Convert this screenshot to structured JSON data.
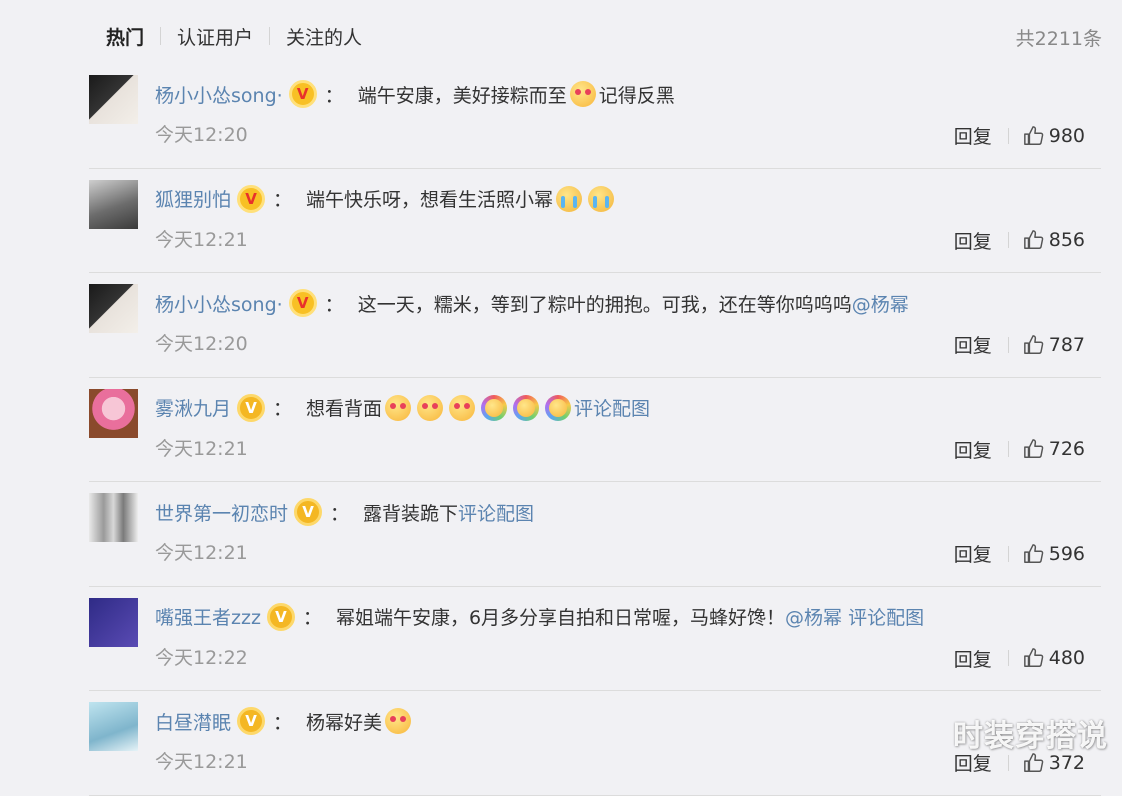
{
  "tabs": [
    "热门",
    "认证用户",
    "关注的人"
  ],
  "total": "共2211条",
  "watermark": "时装穿搭说",
  "reply_label": "回复",
  "comments": [
    {
      "user": "杨小小怂song·",
      "badge": "red",
      "text": "端午安康，美好接粽而至",
      "emoji_after": [
        "heart"
      ],
      "tail": "记得反黑",
      "link": "",
      "time": "今天12:20",
      "likes": "980"
    },
    {
      "user": "狐狸别怕",
      "badge": "red",
      "text": "端午快乐呀，想看生活照小幂",
      "emoji_after": [
        "cry",
        "cry"
      ],
      "tail": "",
      "link": "",
      "time": "今天12:21",
      "likes": "856"
    },
    {
      "user": "杨小小怂song·",
      "badge": "red",
      "text": "这一天，糯米，等到了粽叶的拥抱。可我，还在等你呜呜呜",
      "emoji_after": [],
      "tail": "",
      "link": "@杨幂",
      "time": "今天12:20",
      "likes": "787"
    },
    {
      "user": "雾湫九月",
      "badge": "gold",
      "text": "想看背面",
      "emoji_after": [
        "heart",
        "heart",
        "heart",
        "rainbow",
        "rainbow",
        "rainbow"
      ],
      "tail": "",
      "link": "评论配图",
      "time": "今天12:21",
      "likes": "726"
    },
    {
      "user": "世界第一初恋时",
      "badge": "gold",
      "text": "露背装跪下",
      "emoji_after": [],
      "tail": "",
      "link": "评论配图",
      "time": "今天12:21",
      "likes": "596"
    },
    {
      "user": "嘴强王者zzz",
      "badge": "gold",
      "text": "幂姐端午安康，6月多分享自拍和日常喔，马蜂好馋！",
      "emoji_after": [],
      "tail": "",
      "link": "@杨幂 评论配图",
      "time": "今天12:22",
      "likes": "480"
    },
    {
      "user": "白昼潸眠",
      "badge": "gold",
      "text": "杨幂好美",
      "emoji_after": [
        "heart"
      ],
      "tail": "",
      "link": "",
      "time": "今天12:21",
      "likes": "372"
    }
  ],
  "colors": {
    "link": "#5b84b0",
    "badge_gold": "#f4b723",
    "badge_red_v": "#e8312b",
    "background": "#f1f1f4"
  }
}
